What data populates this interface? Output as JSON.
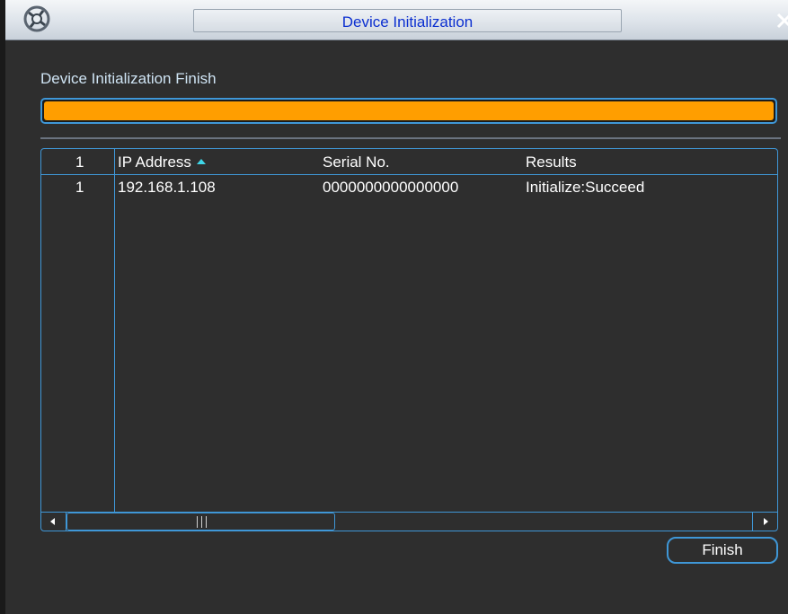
{
  "window": {
    "title": "Device Initialization",
    "logo_icon": "brand-logo-icon",
    "close_icon": "close-icon"
  },
  "status": {
    "label": "Device Initialization Finish",
    "progress_fraction": 1.0,
    "progress_color": "#ff9e00"
  },
  "table": {
    "columns": [
      "1",
      "IP Address",
      "Serial No.",
      "Results"
    ],
    "sort_indicator": "sort-ascending-icon",
    "rows": [
      {
        "index": "1",
        "ip": "192.168.1.108",
        "serial": "0000000000000000",
        "result": "Initialize:Succeed"
      }
    ]
  },
  "actions": {
    "finish_label": "Finish"
  },
  "colors": {
    "accent": "#3f97d7",
    "title_text": "#0b2fd0",
    "background": "#2e2e2e"
  }
}
